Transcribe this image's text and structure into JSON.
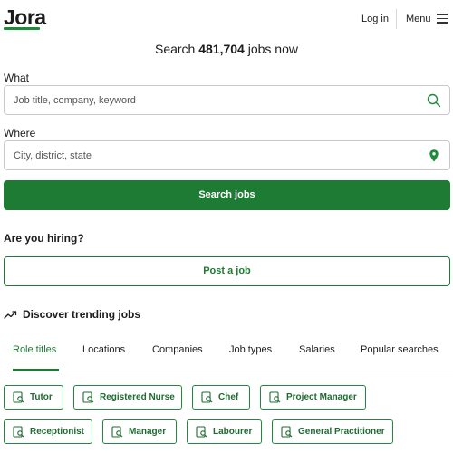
{
  "header": {
    "logo": "Jora",
    "login_label": "Log in",
    "menu_label": "Menu"
  },
  "headline": {
    "prefix": "Search ",
    "count": "481,704",
    "suffix": " jobs now"
  },
  "search": {
    "what_label": "What",
    "what_placeholder": "Job title, company, keyword",
    "what_value": "",
    "where_label": "Where",
    "where_placeholder": "City, district, state",
    "where_value": "",
    "submit_label": "Search jobs"
  },
  "hiring": {
    "title": "Are you hiring?",
    "post_label": "Post a job"
  },
  "trending": {
    "title": "Discover trending jobs",
    "tabs": [
      {
        "label": "Role titles",
        "active": true
      },
      {
        "label": "Locations",
        "active": false
      },
      {
        "label": "Companies",
        "active": false
      },
      {
        "label": "Job types",
        "active": false
      },
      {
        "label": "Salaries",
        "active": false
      },
      {
        "label": "Popular searches",
        "active": false
      }
    ],
    "chips": [
      {
        "label": "Tutor",
        "icon": "search-doc-icon"
      },
      {
        "label": "Registered Nurse",
        "icon": "search-doc-icon"
      },
      {
        "label": "Chef",
        "icon": "search-doc-icon"
      },
      {
        "label": "Project Manager",
        "icon": "search-doc-icon"
      },
      {
        "label": "Receptionist",
        "icon": "search-doc-icon"
      },
      {
        "label": "Manager",
        "icon": "search-doc-icon"
      },
      {
        "label": "Labourer",
        "icon": "search-doc-icon"
      },
      {
        "label": "General Practitioner",
        "icon": "search-doc-icon"
      }
    ]
  },
  "colors": {
    "brand_green": "#1e7b34",
    "text": "#1c1c1c",
    "border": "#c9c9c9"
  }
}
